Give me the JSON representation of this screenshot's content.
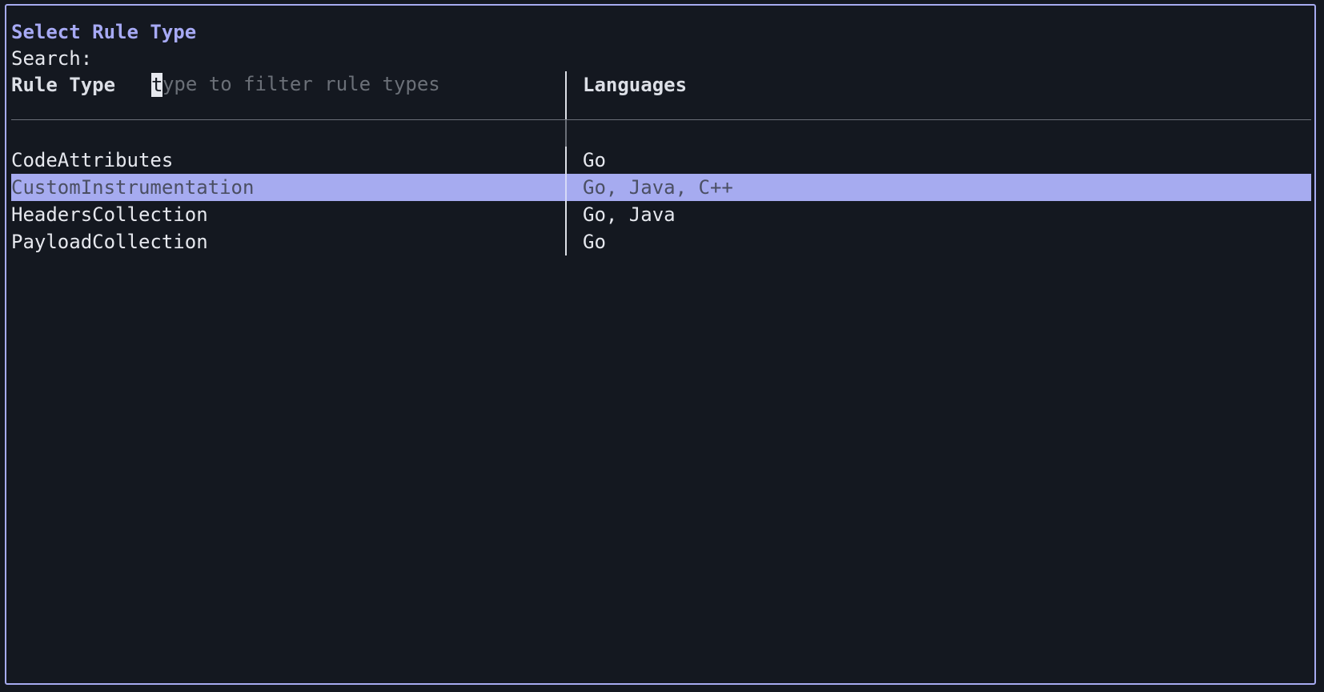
{
  "dialog": {
    "title": "Select Rule Type"
  },
  "search": {
    "label": "Search:",
    "cursor_char": "t",
    "placeholder_rest": "ype to filter rule types"
  },
  "table": {
    "columns": [
      "Rule Type",
      "Languages"
    ],
    "rows": [
      {
        "rule_type": "CodeAttributes",
        "languages": "Go"
      },
      {
        "rule_type": "CustomInstrumentation",
        "languages": "Go, Java, C++"
      },
      {
        "rule_type": "HeadersCollection",
        "languages": "Go, Java"
      },
      {
        "rule_type": "PayloadCollection",
        "languages": "Go"
      }
    ],
    "selected_index": 1
  },
  "colors": {
    "background": "#141820",
    "accent": "#a6abf0",
    "title": "#a7aaf5",
    "placeholder": "#6b7078",
    "text": "#e6e8ee",
    "selected_text": "#4b4f63"
  }
}
